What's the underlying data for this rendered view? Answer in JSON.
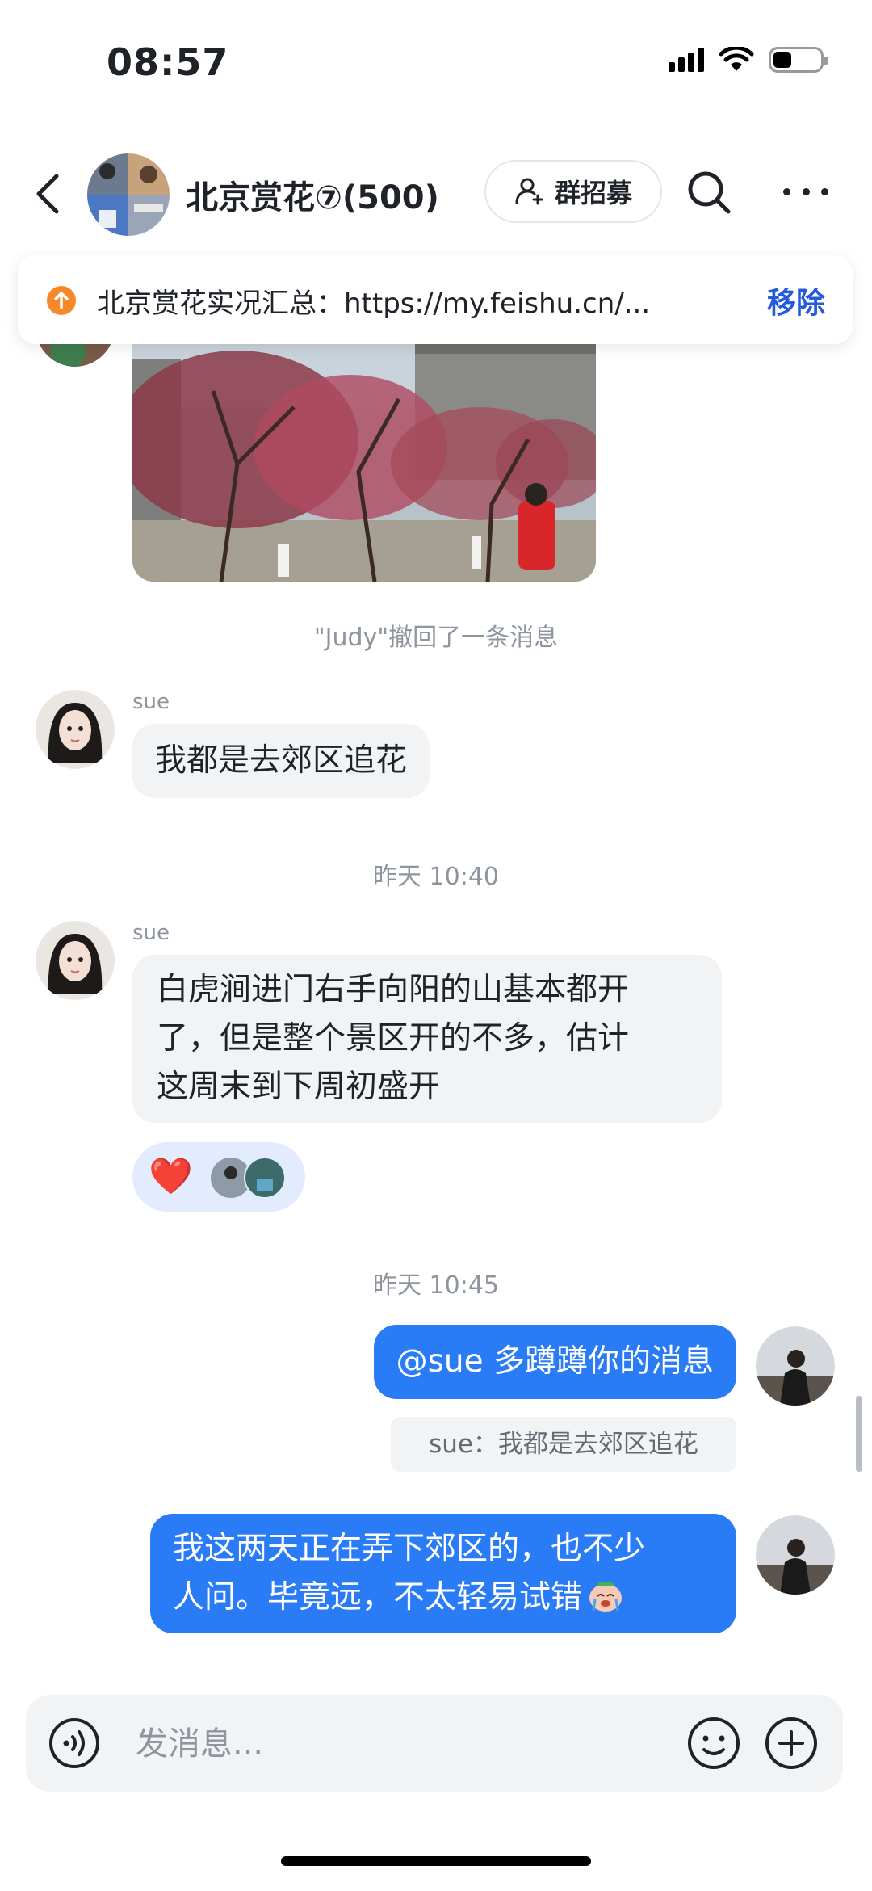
{
  "status_bar": {
    "time": "08:57"
  },
  "header": {
    "title": "北京赏花⑦(500)",
    "recruit_label": "群招募"
  },
  "pinned": {
    "text": "北京赏花实况汇总：https://my.feishu.cn/...",
    "remove_label": "移除"
  },
  "messages": {
    "recall_notice": "\"Judy\"撤回了一条消息",
    "msg1": {
      "sender": "sue",
      "text": "我都是去郊区追花"
    },
    "time1": "昨天 10:40",
    "msg2": {
      "sender": "sue",
      "lines": [
        "白虎涧进门右手向阳的山基本都开",
        "了，但是整个景区开的不多，估计",
        "这周末到下周初盛开"
      ],
      "reaction_emoji": "❤️"
    },
    "time2": "昨天 10:45",
    "msg3": {
      "text": "@sue 多蹲蹲你的消息",
      "quote": "sue：我都是去郊区追花"
    },
    "msg4": {
      "lines": [
        "我这两天正在弄下郊区的，也不少",
        "人问。毕竟远，不太轻易试错"
      ]
    }
  },
  "composer": {
    "placeholder": "发消息..."
  },
  "colors": {
    "accent": "#2a7cf6",
    "link": "#245bdb",
    "bubble_in": "#f2f3f5",
    "pin_icon": "#f5892a"
  },
  "icons": [
    "back-icon",
    "search-icon",
    "more-icon",
    "add-user-icon",
    "pin-icon",
    "voice-icon",
    "emoji-icon",
    "plus-icon"
  ]
}
